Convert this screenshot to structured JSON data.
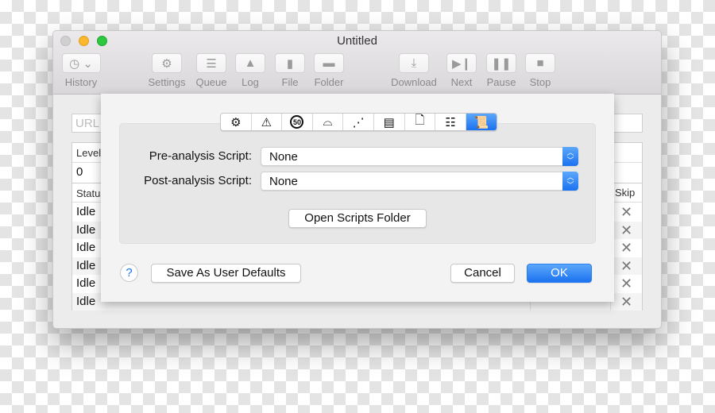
{
  "window": {
    "title": "Untitled"
  },
  "toolbar": [
    {
      "label": "History",
      "icon": "clock-icon",
      "glyph": "◷ ⌄"
    },
    {
      "label": "Settings",
      "icon": "gear-icon",
      "glyph": "⚙"
    },
    {
      "label": "Queue",
      "icon": "list-icon",
      "glyph": "☰"
    },
    {
      "label": "Log",
      "icon": "warning-icon",
      "glyph": "▲"
    },
    {
      "label": "File",
      "icon": "file-icon",
      "glyph": "▮"
    },
    {
      "label": "Folder",
      "icon": "folder-icon",
      "glyph": "▬"
    },
    {
      "label": "Download",
      "icon": "download-icon",
      "glyph": "⤓"
    },
    {
      "label": "Next",
      "icon": "next-icon",
      "glyph": "▶❙"
    },
    {
      "label": "Pause",
      "icon": "pause-icon",
      "glyph": "❚❚"
    },
    {
      "label": "Stop",
      "icon": "stop-icon",
      "glyph": "■"
    }
  ],
  "main": {
    "url_placeholder": "URL",
    "level_header": "Level",
    "level_value": "0",
    "status_header": "Status",
    "skip_header": "Skip",
    "rows": [
      "Idle",
      "Idle",
      "Idle",
      "Idle",
      "Idle",
      "Idle"
    ],
    "skip_glyph": "✕"
  },
  "sheet": {
    "tabs": [
      {
        "icon": "gear-icon",
        "glyph": "⚙"
      },
      {
        "icon": "warning-icon",
        "glyph": "⚠"
      },
      {
        "icon": "speed-limit-icon",
        "glyph": "50"
      },
      {
        "icon": "bell-icon",
        "glyph": "⌓"
      },
      {
        "icon": "graph-icon",
        "glyph": "⋰"
      },
      {
        "icon": "form-icon",
        "glyph": "▤"
      },
      {
        "icon": "document-icon",
        "glyph": "🗋"
      },
      {
        "icon": "sliders-icon",
        "glyph": "☷"
      },
      {
        "icon": "script-icon",
        "glyph": "📜",
        "selected": true
      }
    ],
    "pre_label": "Pre-analysis Script:",
    "pre_value": "None",
    "post_label": "Post-analysis Script:",
    "post_value": "None",
    "open_folder": "Open Scripts Folder",
    "help": "?",
    "save_defaults": "Save As User Defaults",
    "cancel": "Cancel",
    "ok": "OK"
  },
  "colors": {
    "accent": "#1b72f0"
  }
}
